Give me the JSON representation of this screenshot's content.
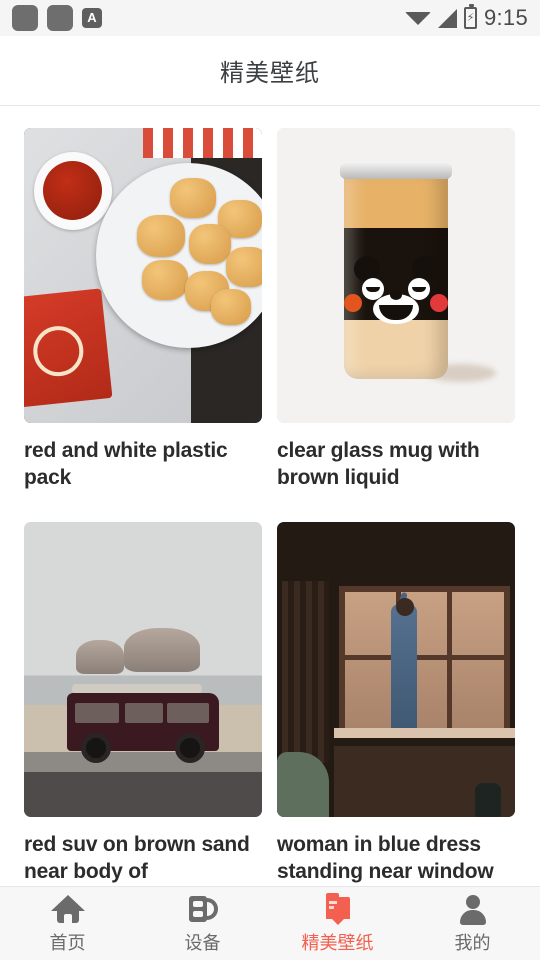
{
  "status_bar": {
    "notification_icons": [
      "app-placeholder-1",
      "app-placeholder-2",
      "a-badge-icon"
    ],
    "a_badge_label": "A",
    "wifi_icon": "wifi-icon",
    "signal_icon": "cellular-signal-icon",
    "battery_icon": "battery-charging-icon",
    "battery_bolt": "⚡",
    "time": "9:15"
  },
  "app_bar": {
    "title": "精美壁纸"
  },
  "gallery": {
    "items": [
      {
        "caption": "red and white plastic pack",
        "art": "nuggets"
      },
      {
        "caption": "clear glass mug with brown liquid",
        "art": "jar"
      },
      {
        "caption": "red suv on brown sand near body of",
        "art": "van"
      },
      {
        "caption": "woman in blue dress standing near window",
        "art": "window"
      }
    ]
  },
  "bottom_nav": {
    "active_color": "#f4604f",
    "inactive_color": "#6b6b6b",
    "items": [
      {
        "label": "首页",
        "icon": "home-icon",
        "active": false
      },
      {
        "label": "设备",
        "icon": "device-icon",
        "active": false
      },
      {
        "label": "精美壁纸",
        "icon": "wallpaper-icon",
        "active": true
      },
      {
        "label": "我的",
        "icon": "person-icon",
        "active": false
      }
    ]
  }
}
